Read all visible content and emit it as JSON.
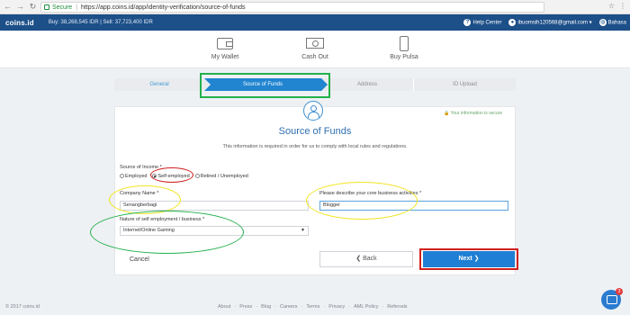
{
  "browser": {
    "secure_label": "Secure",
    "url": "https://app.coins.id/app/identity-verification/source-of-funds"
  },
  "header": {
    "logo": "coins.id",
    "balance": "Buy: 38,268,545 IDR | Sell: 37,723,400 IDR",
    "help": "Help Center",
    "user": "ibuomsih120568@gmail.com",
    "language": "Bahasa"
  },
  "subnav": {
    "items": [
      {
        "label": "My Wallet",
        "icon": "wallet-icon"
      },
      {
        "label": "Cash Out",
        "icon": "cash-icon"
      },
      {
        "label": "Buy Pulsa",
        "icon": "phone-icon"
      }
    ]
  },
  "steps": [
    "General",
    "Source of Funds",
    "Address",
    "ID Upload"
  ],
  "card": {
    "secure_note": "🔒 Your information is secure",
    "title": "Source of Funds",
    "description": "This information is required in order for us to comply with local rules and regulations."
  },
  "form": {
    "income_label": "Source of Income *",
    "income_options": [
      "Employed",
      "Self-employed",
      "Retired / Unemployed"
    ],
    "income_selected": "Self-employed",
    "company_label": "Company Name *",
    "company_value": "Senangberbagi",
    "business_label": "Please describe your core business activities *",
    "business_value": "Blogger",
    "nature_label": "Nature of self employment / business *",
    "nature_value": "Internet/Online Gaming"
  },
  "actions": {
    "cancel": "Cancel",
    "back": "❮ Back",
    "next": "Next ❯"
  },
  "footer": {
    "copyright": "© 2017 coins.id",
    "links": [
      "About",
      "Press",
      "Blog",
      "Careers",
      "Terms",
      "Privacy",
      "AML Policy",
      "Referrals"
    ],
    "separator": "·",
    "chat_badge": "3"
  },
  "colors": {
    "brand": "#1d4f88",
    "accent": "#2185d0",
    "annotation_green": "#22b14c",
    "annotation_red": "#d11f1f",
    "annotation_yellow": "#f1e31d"
  }
}
